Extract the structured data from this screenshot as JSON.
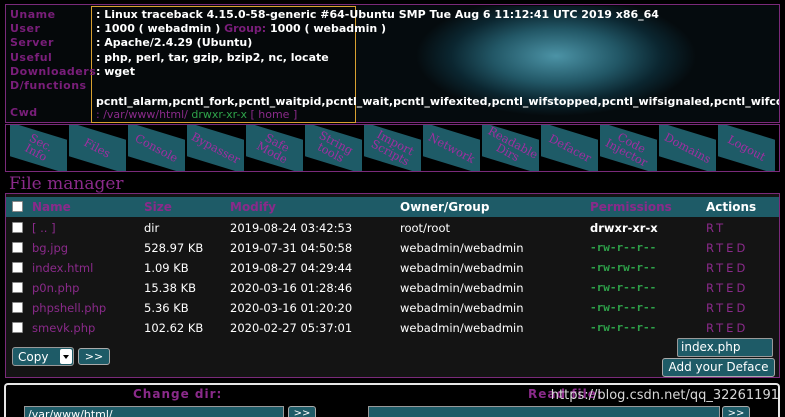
{
  "header": {
    "labels": [
      "Uname",
      "User",
      "Server",
      "Useful",
      "Downloaders",
      "D/functions"
    ],
    "cwd_label": "Cwd",
    "uname": ": Linux traceback 4.15.0-58-generic #64-Ubuntu SMP Tue Aug 6 11:12:41 UTC 2019 x86_64",
    "user_prefix": ": 1000 ( webadmin ) ",
    "group_label": "Group:",
    "group_value": " 1000 ( webadmin )",
    "server": ": Apache/2.4.29 (Ubuntu)",
    "useful": ": php, perl, tar, gzip, bzip2, nc, locate",
    "downloaders": ": wget",
    "disabled_functions": "pcntl_alarm,pcntl_fork,pcntl_waitpid,pcntl_wait,pcntl_wifexited,pcntl_wifstopped,pcntl_wifsignaled,pcntl_wifco",
    "cwd_path": ": /var/www/html/",
    "cwd_perm": "drwxr-xr-x",
    "home_link": "[ home ]"
  },
  "nav": {
    "tabs": [
      {
        "label": "Sec.\nInfo"
      },
      {
        "label": "Files"
      },
      {
        "label": "Console"
      },
      {
        "label": "Bypasser"
      },
      {
        "label": "Safe\nMode"
      },
      {
        "label": "String\ntools"
      },
      {
        "label": "Import\nScripts"
      },
      {
        "label": "Network"
      },
      {
        "label": "Readable\nDirs"
      },
      {
        "label": "Defacer"
      },
      {
        "label": "Code\nInjector"
      },
      {
        "label": "Domains"
      },
      {
        "label": "Logout"
      }
    ]
  },
  "file_manager": {
    "title": "File manager",
    "columns": {
      "name": "Name",
      "size": "Size",
      "modify": "Modify",
      "owner": "Owner/Group",
      "permissions": "Permissions",
      "actions": "Actions"
    },
    "rows": [
      {
        "name": "[ .. ]",
        "size": "dir",
        "modify": "2019-08-24 03:42:53",
        "owner": "root/root",
        "perm": "drwxr-xr-x",
        "actions": "RT",
        "is_dir": true
      },
      {
        "name": "bg.jpg",
        "size": "528.97 KB",
        "modify": "2019-07-31 04:50:58",
        "owner": "webadmin/webadmin",
        "perm": "-rw-r--r--",
        "actions": "RTED",
        "is_dir": false
      },
      {
        "name": "index.html",
        "size": "1.09 KB",
        "modify": "2019-08-27 04:29:44",
        "owner": "webadmin/webadmin",
        "perm": "-rw-rw-r--",
        "actions": "RTED",
        "is_dir": false
      },
      {
        "name": "p0n.php",
        "size": "15.38 KB",
        "modify": "2020-03-16 01:28:46",
        "owner": "webadmin/webadmin",
        "perm": "-rw-r--r--",
        "actions": "RTED",
        "is_dir": false
      },
      {
        "name": "phpshell.php",
        "size": "5.36 KB",
        "modify": "2020-03-16 01:20:20",
        "owner": "webadmin/webadmin",
        "perm": "-rw-r--r--",
        "actions": "RTED",
        "is_dir": false
      },
      {
        "name": "smevk.php",
        "size": "102.62 KB",
        "modify": "2020-02-27 05:37:01",
        "owner": "webadmin/webadmin",
        "perm": "-rw-r--r--",
        "actions": "RTED",
        "is_dir": false
      }
    ],
    "bulk_action": "Copy",
    "go_label": ">>",
    "deface_filename": "index.php",
    "deface_button": "Add your Deface"
  },
  "bottom": {
    "change_dir_label": "Change dir:",
    "change_dir_value": "/var/www/html/",
    "go_label": ">>",
    "read_file_label": "Read file:",
    "read_go_label": ">>"
  },
  "watermark": "https://blog.csdn.net/qq_32261191"
}
